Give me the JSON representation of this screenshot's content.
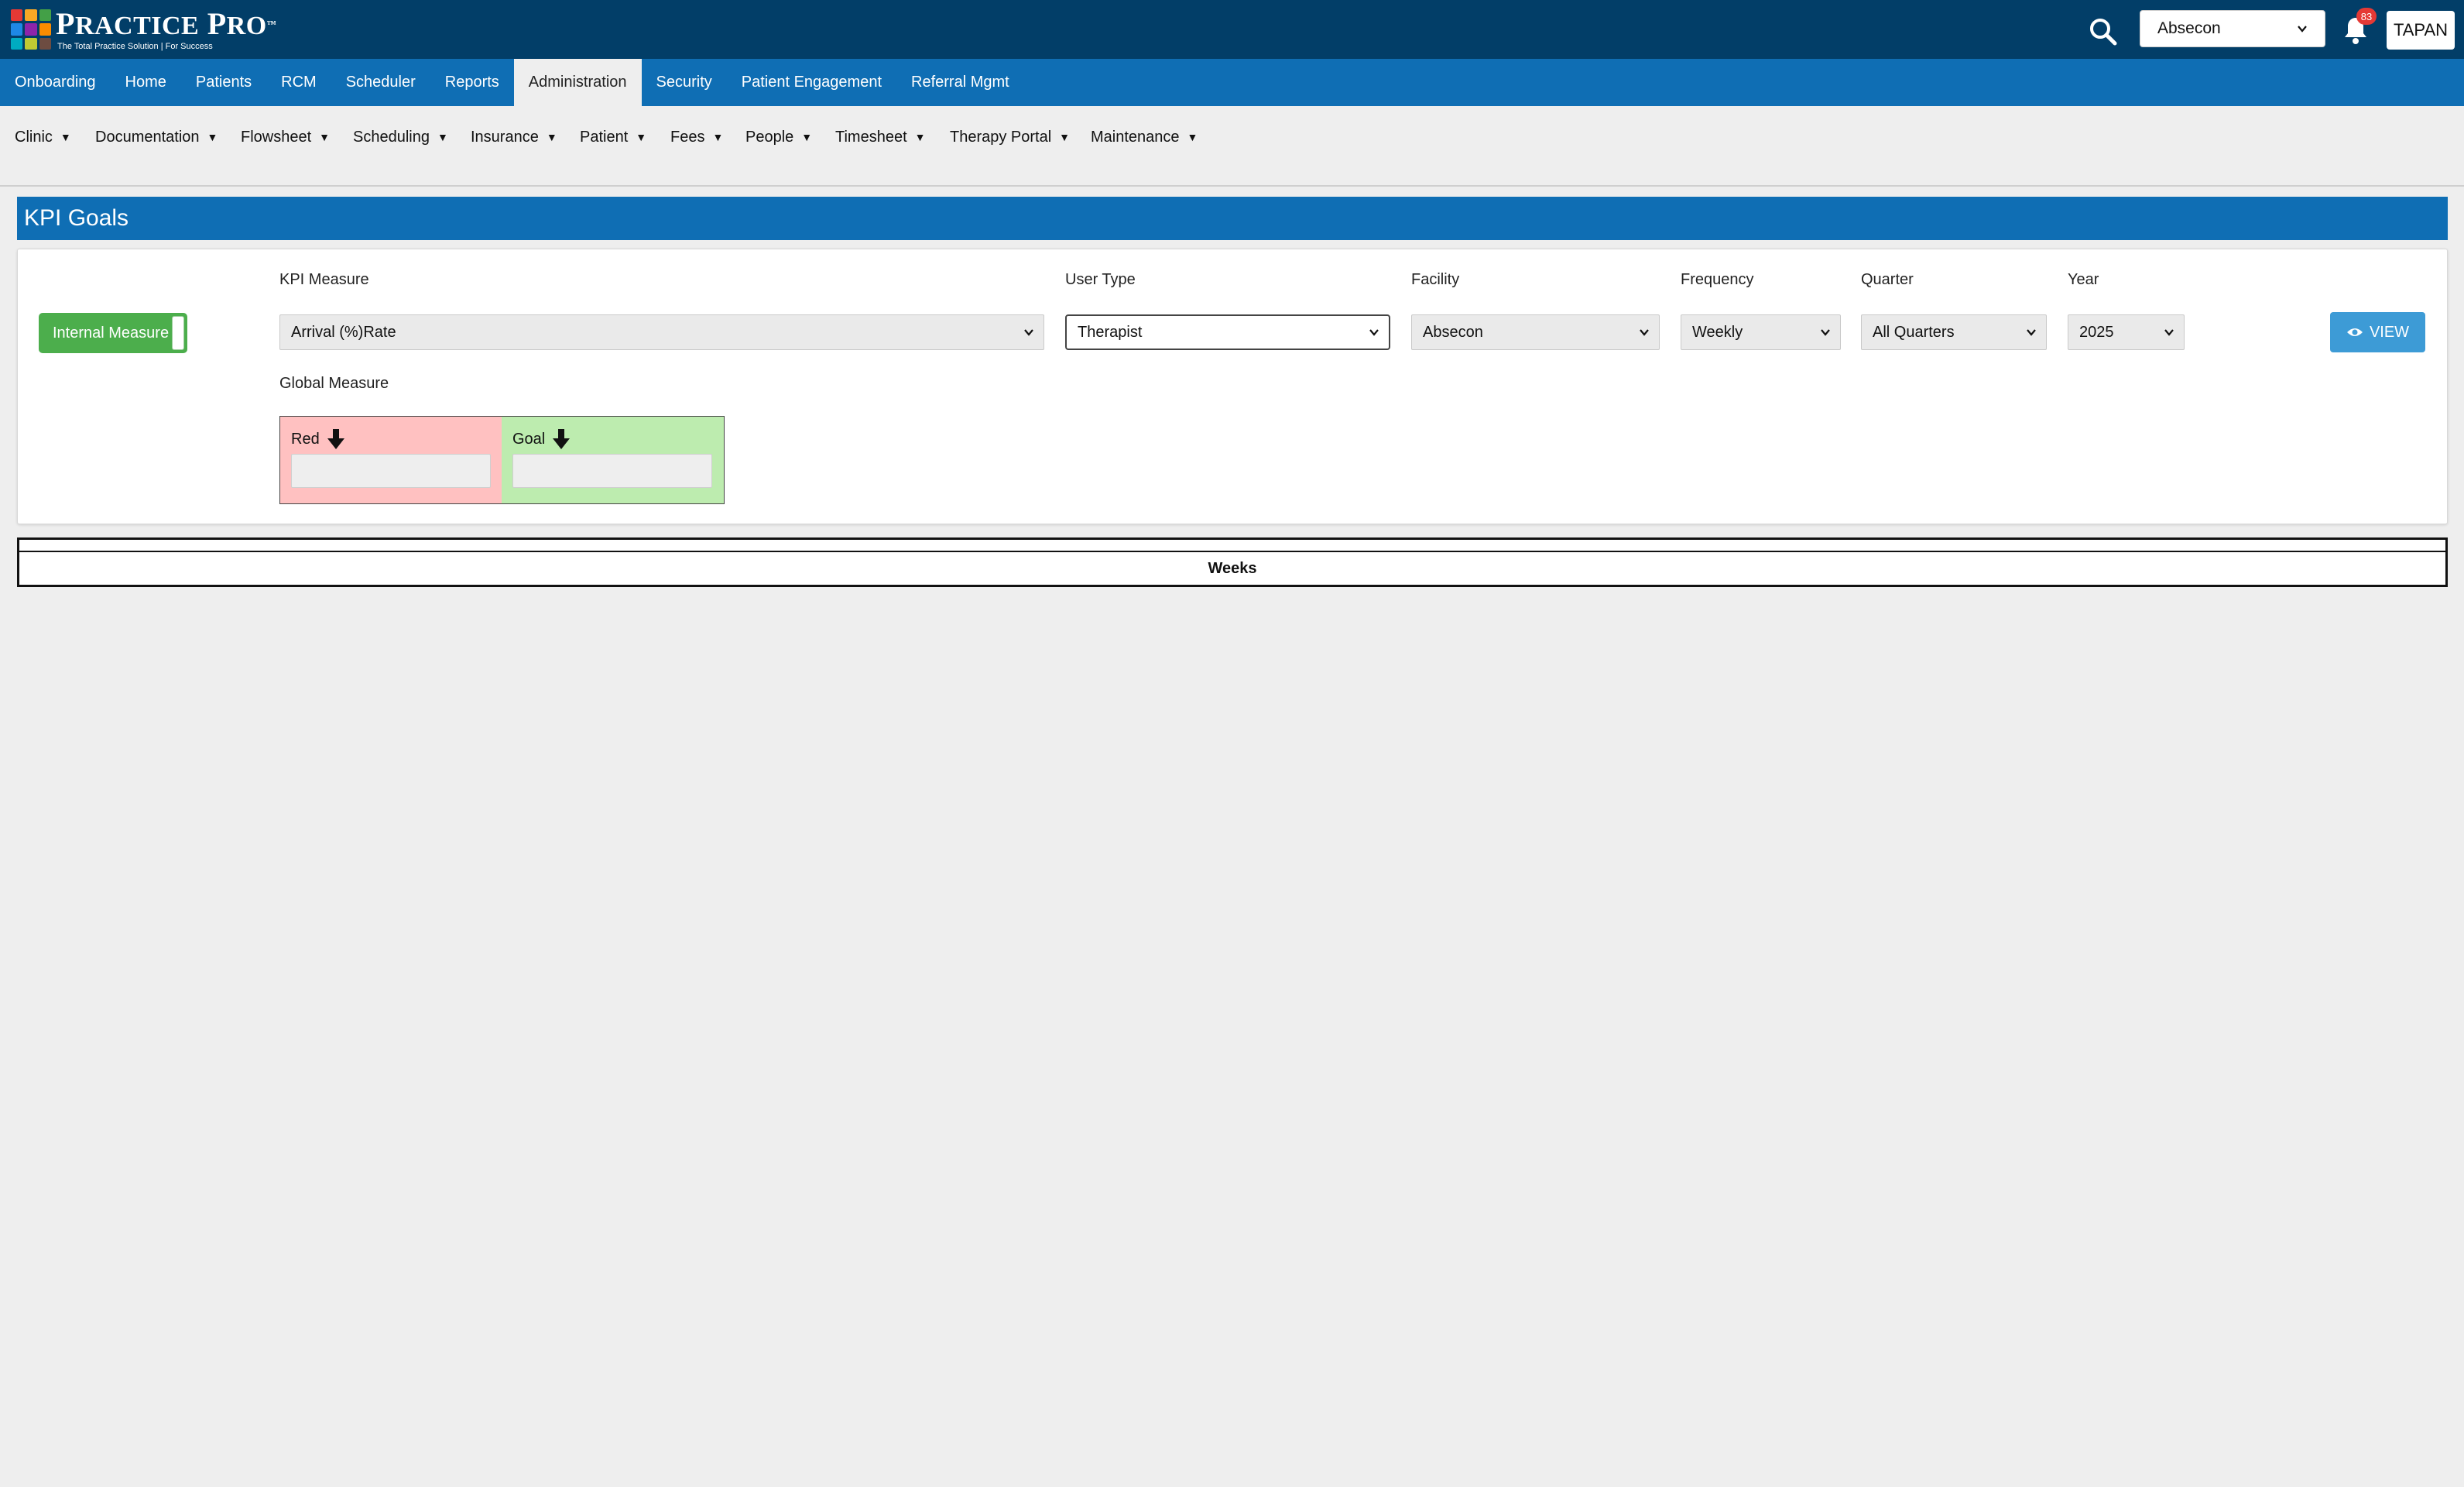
{
  "header": {
    "logo_title_big": "P",
    "logo_title_rest": "RACTICE",
    "logo_title_big2": "P",
    "logo_title_rest2": "RO",
    "logo_tm": "™",
    "logo_tagline": "The Total Practice Solution | For Success",
    "logo_colors": [
      "#e53935",
      "#f9a825",
      "#43a047",
      "#1e88e5",
      "#8e24aa",
      "#fb8c00",
      "#00acc1",
      "#c0ca33",
      "#6d4c41"
    ],
    "facility_selected": "Absecon",
    "notification_count": "83",
    "user_label": "TAPAN",
    "search_icon": "search-icon",
    "bell_icon": "bell-icon"
  },
  "main_nav": {
    "items": [
      {
        "label": "Onboarding"
      },
      {
        "label": "Home"
      },
      {
        "label": "Patients"
      },
      {
        "label": "RCM"
      },
      {
        "label": "Scheduler"
      },
      {
        "label": "Reports"
      },
      {
        "label": "Administration"
      },
      {
        "label": "Security"
      },
      {
        "label": "Patient Engagement"
      },
      {
        "label": "Referral Mgmt"
      }
    ],
    "active": "Administration"
  },
  "sub_nav": {
    "items": [
      {
        "label": "Clinic"
      },
      {
        "label": "Documentation"
      },
      {
        "label": "Flowsheet"
      },
      {
        "label": "Scheduling"
      },
      {
        "label": "Insurance"
      },
      {
        "label": "Patient"
      },
      {
        "label": "Fees"
      },
      {
        "label": "People"
      },
      {
        "label": "Timesheet"
      },
      {
        "label": "Therapy Portal"
      },
      {
        "label": "Maintenance"
      }
    ],
    "caret": "▼"
  },
  "page": {
    "title": "KPI Goals"
  },
  "filters": {
    "toggle_label": "Internal Measure",
    "kpi_measure": {
      "label": "KPI Measure",
      "value": "Arrival (%)Rate"
    },
    "user_type": {
      "label": "User Type",
      "value": "Therapist"
    },
    "facility": {
      "label": "Facility",
      "value": "Absecon"
    },
    "frequency": {
      "label": "Frequency",
      "value": "Weekly"
    },
    "quarter": {
      "label": "Quarter",
      "value": "All Quarters"
    },
    "year": {
      "label": "Year",
      "value": "2025"
    },
    "view_button": "VIEW",
    "global_measure_label": "Global Measure",
    "red_label": "Red",
    "goal_label": "Goal",
    "red_value": "",
    "goal_value": ""
  },
  "table": {
    "header": "Weeks"
  },
  "colors": {
    "topbar": "#023e68",
    "nav": "#0f6eb4",
    "toggle_green": "#4cae4c",
    "view_blue": "#3d9bd6",
    "red_zone": "#ffc1c1",
    "goal_zone": "#bdecaf"
  }
}
